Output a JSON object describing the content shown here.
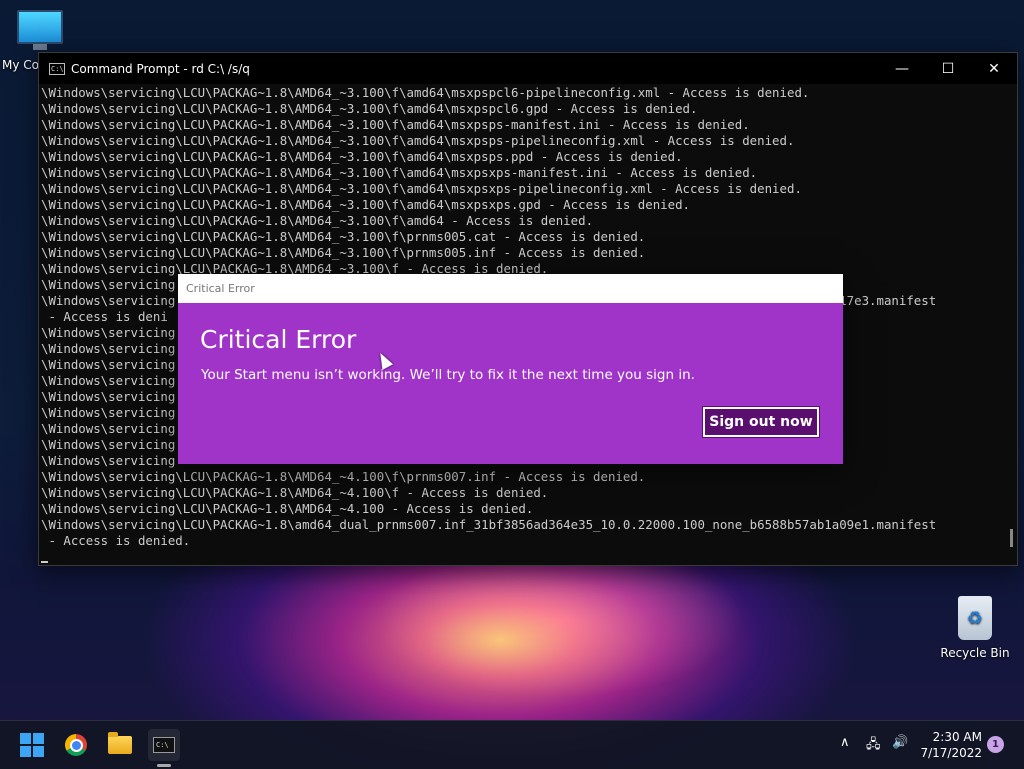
{
  "desktop": {
    "icons": [
      {
        "label": "My Co"
      },
      {
        "label": "Recycle Bin"
      }
    ]
  },
  "cmd_window": {
    "title": "Command Prompt - rd  C:\\ /s/q",
    "icon_text": "C:\\",
    "buttons": {
      "minimize": "—",
      "maximize": "☐",
      "close": "✕"
    },
    "lines": [
      "\\Windows\\servicing\\LCU\\PACKAG~1.8\\AMD64_~3.100\\f\\amd64\\msxpspcl6-pipelineconfig.xml - Access is denied.",
      "\\Windows\\servicing\\LCU\\PACKAG~1.8\\AMD64_~3.100\\f\\amd64\\msxpspcl6.gpd - Access is denied.",
      "\\Windows\\servicing\\LCU\\PACKAG~1.8\\AMD64_~3.100\\f\\amd64\\msxpsps-manifest.ini - Access is denied.",
      "\\Windows\\servicing\\LCU\\PACKAG~1.8\\AMD64_~3.100\\f\\amd64\\msxpsps-pipelineconfig.xml - Access is denied.",
      "\\Windows\\servicing\\LCU\\PACKAG~1.8\\AMD64_~3.100\\f\\amd64\\msxpsps.ppd - Access is denied.",
      "\\Windows\\servicing\\LCU\\PACKAG~1.8\\AMD64_~3.100\\f\\amd64\\msxpsxps-manifest.ini - Access is denied.",
      "\\Windows\\servicing\\LCU\\PACKAG~1.8\\AMD64_~3.100\\f\\amd64\\msxpsxps-pipelineconfig.xml - Access is denied.",
      "\\Windows\\servicing\\LCU\\PACKAG~1.8\\AMD64_~3.100\\f\\amd64\\msxpsxps.gpd - Access is denied.",
      "\\Windows\\servicing\\LCU\\PACKAG~1.8\\AMD64_~3.100\\f\\amd64 - Access is denied.",
      "\\Windows\\servicing\\LCU\\PACKAG~1.8\\AMD64_~3.100\\f\\prnms005.cat - Access is denied.",
      "\\Windows\\servicing\\LCU\\PACKAG~1.8\\AMD64_~3.100\\f\\prnms005.inf - Access is denied.",
      "\\Windows\\servicing\\LCU\\PACKAG~1.8\\AMD64_~3.100\\f - Access is denied.",
      "\\Windows\\servicing",
      "\\Windows\\servicing                                                                                  f14b94e17e3.manifest",
      " - Access is deni",
      "\\Windows\\servicing",
      "\\Windows\\servicing                                                                                  denied.",
      "\\Windows\\servicing",
      "\\Windows\\servicing",
      "\\Windows\\servicing",
      "\\Windows\\servicing",
      "\\Windows\\servicing",
      "\\Windows\\servicing",
      "\\Windows\\servicing",
      "\\Windows\\servicing\\LCU\\PACKAG~1.8\\AMD64_~4.100\\f\\prnms007.inf - Access is denied.",
      "\\Windows\\servicing\\LCU\\PACKAG~1.8\\AMD64_~4.100\\f - Access is denied.",
      "\\Windows\\servicing\\LCU\\PACKAG~1.8\\AMD64_~4.100 - Access is denied.",
      "\\Windows\\servicing\\LCU\\PACKAG~1.8\\amd64_dual_prnms007.inf_31bf3856ad364e35_10.0.22000.100_none_b6588b57ab1a09e1.manifest",
      " - Access is denied."
    ]
  },
  "dialog": {
    "window_title": "Critical Error",
    "heading": "Critical Error",
    "message": "Your Start menu isn’t working. We’ll try to fix it the next time you sign in.",
    "button": "Sign out now",
    "accent": "#a033c8"
  },
  "taskbar": {
    "apps": [
      "start-icon",
      "chrome-icon",
      "file-explorer-icon",
      "command-prompt-icon"
    ],
    "tray": {
      "chevron": "∧",
      "network": "🖧",
      "volume": "🔊"
    },
    "time": "2:30 AM",
    "date": "7/17/2022",
    "notification_count": "1"
  }
}
